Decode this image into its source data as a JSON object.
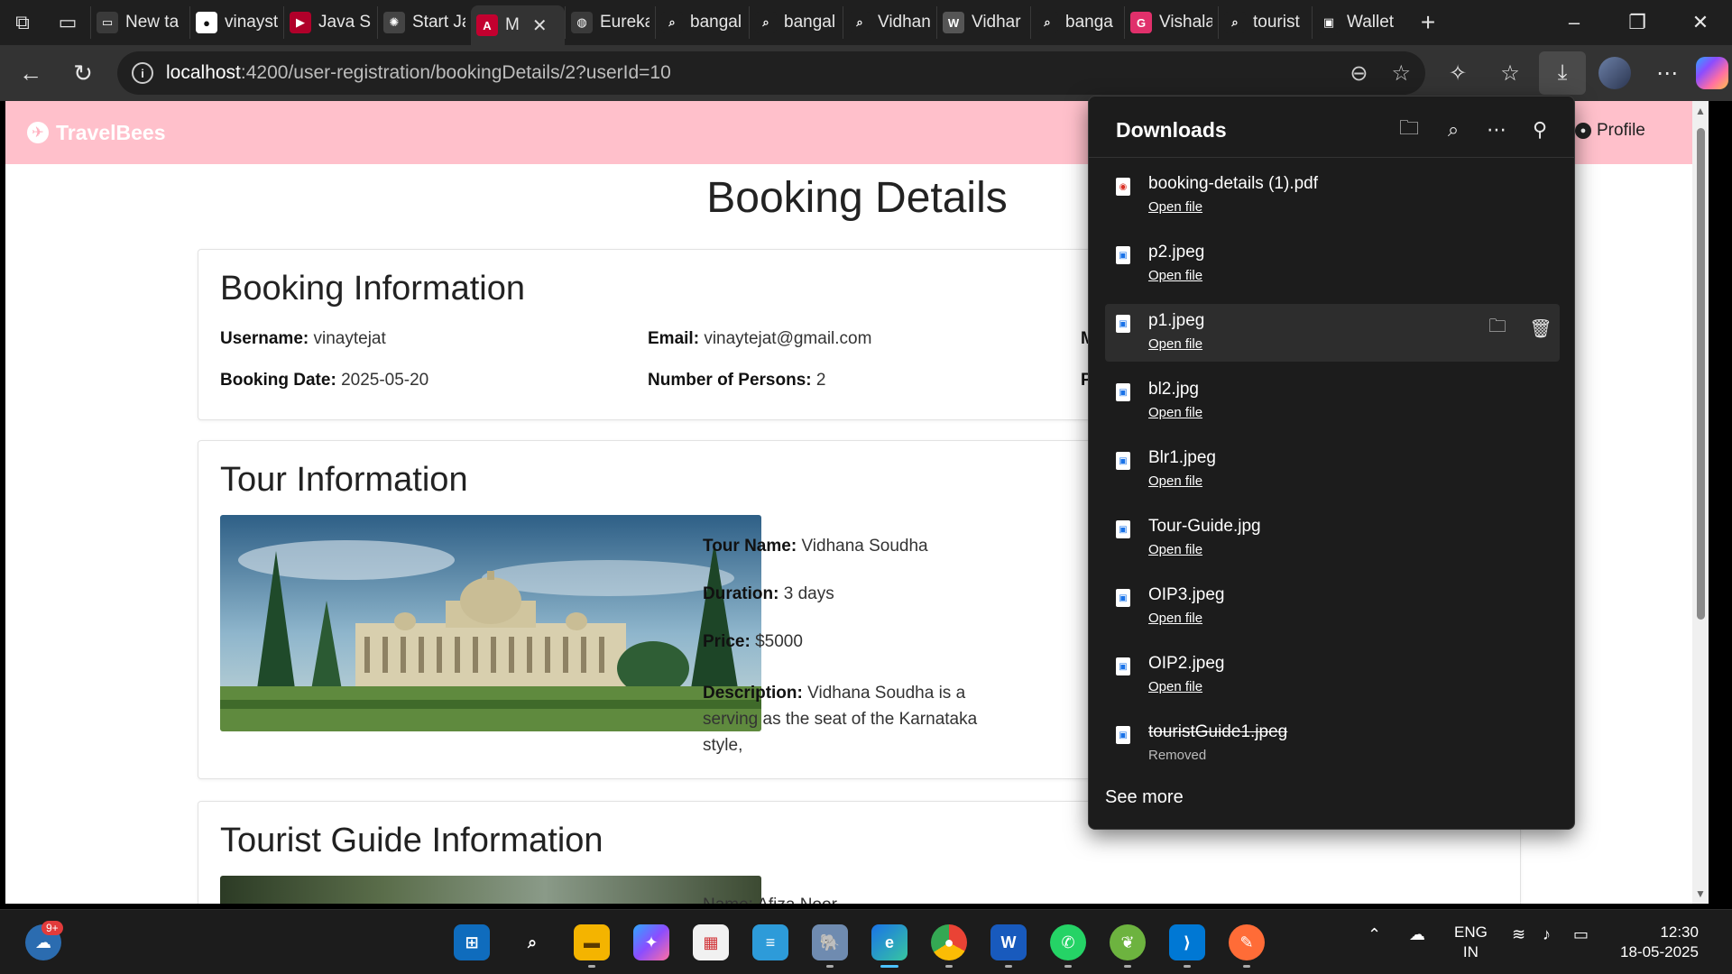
{
  "browser": {
    "tabs": [
      {
        "title": "New ta",
        "fav": "▭",
        "color": "#3a3a3a"
      },
      {
        "title": "vinayst",
        "fav": "●",
        "color": "#ffffff"
      },
      {
        "title": "Java Sp",
        "fav": "▶",
        "color": "#b0002a"
      },
      {
        "title": "Start Ja",
        "fav": "✺",
        "color": "#444444"
      },
      {
        "title": "M",
        "fav": "A",
        "color": "#c3002f",
        "active": true
      },
      {
        "title": "Eureka",
        "fav": "◍",
        "color": "#3a3a3a"
      },
      {
        "title": "bangal",
        "fav": "⌕",
        "color": "#1f1f1f"
      },
      {
        "title": "bangal",
        "fav": "⌕",
        "color": "#1f1f1f"
      },
      {
        "title": "Vidhan",
        "fav": "⌕",
        "color": "#1f1f1f"
      },
      {
        "title": "Vidhar",
        "fav": "W",
        "color": "#555555"
      },
      {
        "title": "banga",
        "fav": "⌕",
        "color": "#1f1f1f"
      },
      {
        "title": "Vishala",
        "fav": "G",
        "color": "#e0306b"
      },
      {
        "title": "tourist",
        "fav": "⌕",
        "color": "#1f1f1f"
      },
      {
        "title": "Wallet",
        "fav": "▣",
        "color": "#1f1f1f"
      }
    ],
    "url_host": "localhost",
    "url_path": ":4200/user-registration/bookingDetails/2?userId=10"
  },
  "app": {
    "brand": "TravelBees",
    "profile": "Profile",
    "page_title": "Booking Details"
  },
  "booking": {
    "heading": "Booking Information",
    "username_label": "Username:",
    "username": "vinaytejat",
    "email_label": "Email:",
    "email": "vinaytejat@gmail.com",
    "col3_row1_partial": "M",
    "booking_date_label": "Booking Date:",
    "booking_date": "2025-05-20",
    "persons_label": "Number of Persons:",
    "persons": "2",
    "col3_row2_partial": "P"
  },
  "tour": {
    "heading": "Tour Information",
    "name_label": "Tour Name:",
    "name": "Vidhana Soudha",
    "duration_label": "Duration:",
    "duration": "3 days",
    "price_label": "Price:",
    "price": "$5000",
    "desc_label": "Description:",
    "desc_line1": "Vidhana Soudha is a",
    "desc_line2": "serving as the seat of the Karnataka",
    "desc_line3": "style,"
  },
  "guide": {
    "heading": "Tourist Guide Information",
    "name_partial": "Name: Afiza Noor"
  },
  "downloads": {
    "title": "Downloads",
    "open_label": "Open file",
    "removed_label": "Removed",
    "see_more": "See more",
    "items": [
      {
        "name": "booking-details (1).pdf",
        "type": "pdf",
        "removed": false
      },
      {
        "name": "p2.jpeg",
        "type": "img",
        "removed": false
      },
      {
        "name": "p1.jpeg",
        "type": "img",
        "removed": false,
        "hover": true
      },
      {
        "name": "bl2.jpg",
        "type": "img",
        "removed": false
      },
      {
        "name": "Blr1.jpeg",
        "type": "img",
        "removed": false
      },
      {
        "name": "Tour-Guide.jpg",
        "type": "img",
        "removed": false
      },
      {
        "name": "OIP3.jpeg",
        "type": "img",
        "removed": false
      },
      {
        "name": "OIP2.jpeg",
        "type": "img",
        "removed": false
      },
      {
        "name": "touristGuide1.jpeg",
        "type": "img",
        "removed": true
      }
    ]
  },
  "taskbar": {
    "notification_badge": "9+",
    "lang_line1": "ENG",
    "lang_line2": "IN",
    "time": "12:30",
    "date": "18-05-2025"
  }
}
